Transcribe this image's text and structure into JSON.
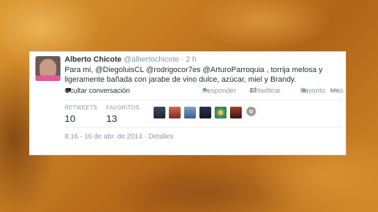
{
  "tweet": {
    "name": "Alberto Chicote",
    "handle": "@albertochicote",
    "time_separator": "·",
    "time": "2 h",
    "text_line1": "Para mi, @DiegoluisCL @rodrigocor7es @ArturoParroquia , torrija melosa y",
    "text_line2": "ligeramente bañada con jarabe de vino dulce, azúcar, miel y Brandy.",
    "actions": {
      "hide_conversation": "Ocultar conversación",
      "reply": "Responder",
      "retweet": "Retwittear",
      "favorite": "Favorito",
      "more": "Más"
    },
    "stats": {
      "retweets_label": "RETWEETS",
      "retweets_value": "10",
      "favorites_label": "FAVORITOS",
      "favorites_value": "13"
    },
    "footer": {
      "datetime": "8:16 - 16 de abr. de 2014",
      "separator": "·",
      "details": "Detalles"
    },
    "icons": {
      "hide": "speech-bubble-icon",
      "reply": "reply-arrow-icon",
      "retweet": "retweet-icon",
      "favorite": "star-icon",
      "more": "ellipsis-icon"
    }
  },
  "colors": {
    "link": "#292f33",
    "muted": "#8899a6",
    "card_bg": "#ffffff"
  }
}
